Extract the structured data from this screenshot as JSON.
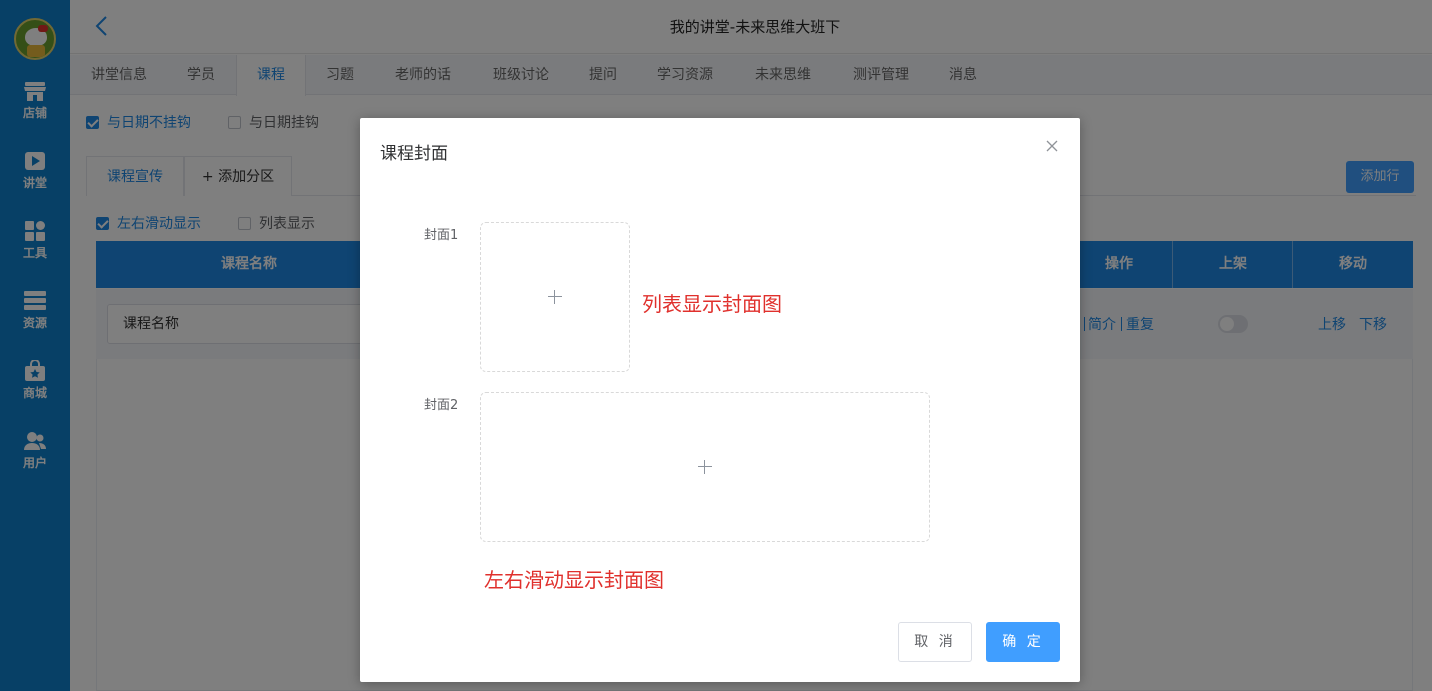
{
  "header": {
    "title": "我的讲堂-未来思维大班下"
  },
  "sidebar": {
    "items": [
      {
        "label": "店铺",
        "icon": "store-icon"
      },
      {
        "label": "讲堂",
        "icon": "video-play-icon"
      },
      {
        "label": "工具",
        "icon": "tools-grid-icon"
      },
      {
        "label": "资源",
        "icon": "resource-stack-icon"
      },
      {
        "label": "商城",
        "icon": "mall-bag-icon"
      },
      {
        "label": "用户",
        "icon": "users-icon"
      }
    ]
  },
  "tabs": [
    {
      "label": "讲堂信息"
    },
    {
      "label": "学员"
    },
    {
      "label": "课程",
      "active": true
    },
    {
      "label": "习题"
    },
    {
      "label": "老师的话"
    },
    {
      "label": "班级讨论"
    },
    {
      "label": "提问"
    },
    {
      "label": "学习资源"
    },
    {
      "label": "未来思维"
    },
    {
      "label": "测评管理"
    },
    {
      "label": "消息"
    }
  ],
  "filters": {
    "date_unlinked": {
      "label": "与日期不挂钩",
      "checked": true
    },
    "date_linked": {
      "label": "与日期挂钩",
      "checked": false
    }
  },
  "subtabs": {
    "promo": "课程宣传",
    "add_section": "+ 添加分区",
    "add_row": "添加行"
  },
  "display": {
    "slide": {
      "label": "左右滑动显示",
      "checked": true
    },
    "list": {
      "label": "列表显示",
      "checked": false
    }
  },
  "table": {
    "columns": {
      "name": "课程名称",
      "ops": "操作",
      "shelf": "上架",
      "move": "移动"
    },
    "row": {
      "name_value": "课程名称",
      "op_intro": "简介",
      "op_repeat": "重复",
      "shelf_on": false,
      "move_up": "上移",
      "move_down": "下移"
    }
  },
  "modal": {
    "title": "课程封面",
    "cover1_label": "封面1",
    "cover2_label": "封面2",
    "cover1_hint": "列表显示封面图",
    "cover2_hint": "左右滑动显示封面图",
    "cancel": "取 消",
    "confirm": "确 定"
  },
  "colors": {
    "sidebar": "#0f80cc",
    "accent": "#1e88e5",
    "primary_button": "#409eff",
    "hint_red": "#e0302c"
  }
}
